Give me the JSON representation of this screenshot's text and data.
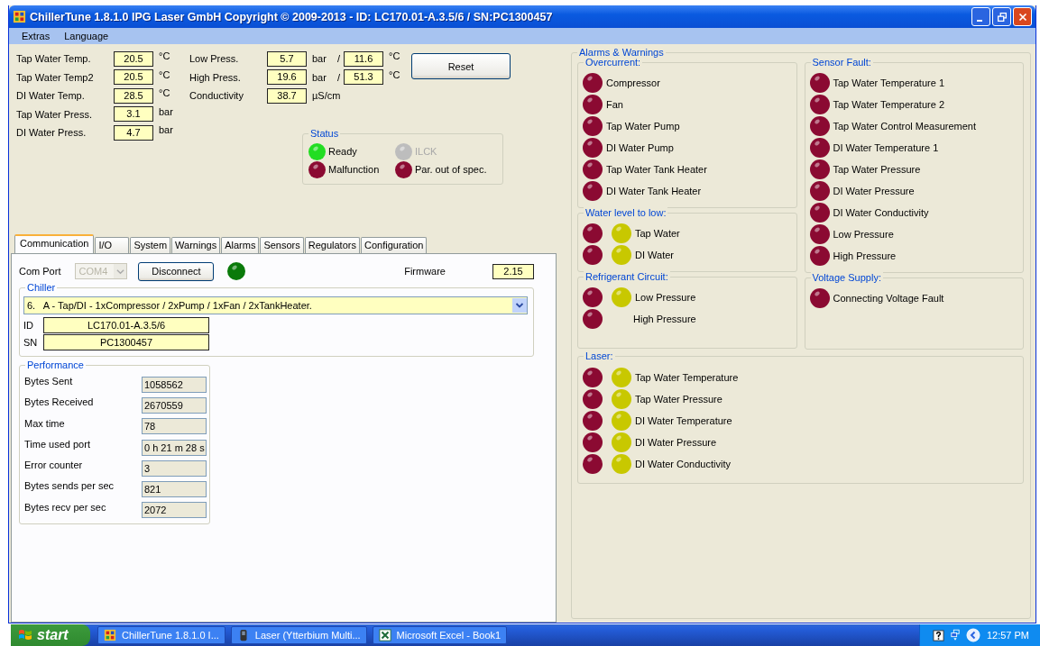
{
  "window": {
    "title": "ChillerTune 1.8.1.0 IPG Laser GmbH Copyright © 2009-2013 - ID: LC170.01-A.3.5/6 / SN:PC1300457"
  },
  "menu": [
    "Extras",
    "Language"
  ],
  "readings_left": [
    {
      "label": "Tap Water Temp.",
      "value": "20.5",
      "unit": "°C"
    },
    {
      "label": "Tap Water Temp2",
      "value": "20.5",
      "unit": "°C"
    },
    {
      "label": "DI Water Temp.",
      "value": "28.5",
      "unit": "°C"
    },
    {
      "label": "Tap Water Press.",
      "value": "3.1",
      "unit": "bar"
    },
    {
      "label": "DI Water Press.",
      "value": "4.7",
      "unit": "bar"
    }
  ],
  "readings_right": [
    {
      "label": "Low Press.",
      "value": "5.7",
      "unit": "bar",
      "separator": "/",
      "value2": "11.6",
      "unit2": "°C"
    },
    {
      "label": "High Press.",
      "value": "19.6",
      "unit": "bar",
      "separator": "/",
      "value2": "51.3",
      "unit2": "°C"
    },
    {
      "label": "Conductivity",
      "value": "38.7",
      "unit": "µS/cm"
    }
  ],
  "reset_button": "Reset",
  "status": {
    "title": "Status",
    "items": [
      {
        "label": "Ready",
        "color": "#22dd22",
        "disabled": false
      },
      {
        "label": "ILCK",
        "color": "#bdbdbd",
        "disabled": true
      },
      {
        "label": "Malfunction",
        "color": "#8b0a32",
        "disabled": false
      },
      {
        "label": "Par. out of spec.",
        "color": "#8b0a32",
        "disabled": false
      }
    ]
  },
  "tabs": [
    {
      "label": "Communication",
      "selected": true
    },
    {
      "label": "I/O",
      "selected": false
    },
    {
      "label": "System",
      "selected": false
    },
    {
      "label": "Warnings",
      "selected": false
    },
    {
      "label": "Alarms",
      "selected": false
    },
    {
      "label": "Sensors",
      "selected": false
    },
    {
      "label": "Regulators",
      "selected": false
    },
    {
      "label": "Configuration",
      "selected": false
    }
  ],
  "communication": {
    "com_port": {
      "label": "Com Port",
      "value": "COM4",
      "disabled": true
    },
    "disconnect_button": "Disconnect",
    "connection_led": {
      "color": "#0a7a0a"
    },
    "firmware": {
      "label": "Firmware",
      "value": "2.15"
    }
  },
  "chiller": {
    "title": "Chiller",
    "model": "6.   A - Tap/DI - 1xCompressor / 2xPump / 1xFan / 2xTankHeater.",
    "fields": [
      {
        "label": "ID",
        "value": "LC170.01-A.3.5/6"
      },
      {
        "label": "SN",
        "value": "PC1300457"
      }
    ]
  },
  "performance": {
    "title": "Performance",
    "rows": [
      {
        "label": "Bytes Sent",
        "value": "1058562"
      },
      {
        "label": "Bytes Received",
        "value": "2670559"
      },
      {
        "label": "Max time",
        "value": "78"
      },
      {
        "label": "Time used port",
        "value": "0 h 21 m 28 s"
      },
      {
        "label": "Error counter",
        "value": "3"
      },
      {
        "label": "Bytes sends per sec",
        "value": "821"
      },
      {
        "label": "Bytes recv per sec",
        "value": "2072"
      }
    ]
  },
  "alarms": {
    "title": "Alarms & Warnings",
    "columns": [
      {
        "groups": [
          {
            "title": "Overcurrent:",
            "kind": "single",
            "items": [
              {
                "label": "Compressor",
                "leds": [
                  {
                    "color": "#8b0a32"
                  }
                ]
              },
              {
                "label": "Fan",
                "leds": [
                  {
                    "color": "#8b0a32"
                  }
                ]
              },
              {
                "label": "Tap Water Pump",
                "leds": [
                  {
                    "color": "#8b0a32"
                  }
                ]
              },
              {
                "label": "DI Water Pump",
                "leds": [
                  {
                    "color": "#8b0a32"
                  }
                ]
              },
              {
                "label": "Tap Water Tank Heater",
                "leds": [
                  {
                    "color": "#8b0a32"
                  }
                ]
              },
              {
                "label": "DI Water Tank Heater",
                "leds": [
                  {
                    "color": "#8b0a32"
                  }
                ]
              }
            ]
          },
          {
            "title": "Water level to low:",
            "kind": "dual",
            "items": [
              {
                "label": "Tap Water",
                "leds": [
                  {
                    "color": "#8b0a32"
                  },
                  {
                    "color": "#c8c800"
                  }
                ]
              },
              {
                "label": "DI Water",
                "leds": [
                  {
                    "color": "#8b0a32"
                  },
                  {
                    "color": "#c8c800"
                  }
                ]
              }
            ]
          },
          {
            "title": "Refrigerant Circuit:",
            "kind": "dual",
            "items": [
              {
                "label": "Low Pressure",
                "leds": [
                  {
                    "color": "#8b0a32"
                  },
                  {
                    "color": "#c8c800"
                  }
                ]
              },
              {
                "label": "High Pressure",
                "leds": [
                  {
                    "color": "#8b0a32"
                  }
                ]
              }
            ]
          }
        ]
      },
      {
        "groups": [
          {
            "title": "Sensor Fault:",
            "kind": "single",
            "items": [
              {
                "label": "Tap Water Temperature 1",
                "leds": [
                  {
                    "color": "#8b0a32"
                  }
                ]
              },
              {
                "label": "Tap Water Temperature 2",
                "leds": [
                  {
                    "color": "#8b0a32"
                  }
                ]
              },
              {
                "label": "Tap Water Control Measurement",
                "leds": [
                  {
                    "color": "#8b0a32"
                  }
                ]
              },
              {
                "label": "DI Water Temperature 1",
                "leds": [
                  {
                    "color": "#8b0a32"
                  }
                ]
              },
              {
                "label": "Tap Water Pressure",
                "leds": [
                  {
                    "color": "#8b0a32"
                  }
                ]
              },
              {
                "label": "DI Water Pressure",
                "leds": [
                  {
                    "color": "#8b0a32"
                  }
                ]
              },
              {
                "label": "DI Water Conductivity",
                "leds": [
                  {
                    "color": "#8b0a32"
                  }
                ]
              },
              {
                "label": "Low Pressure",
                "leds": [
                  {
                    "color": "#8b0a32"
                  }
                ]
              },
              {
                "label": "High Pressure",
                "leds": [
                  {
                    "color": "#8b0a32"
                  }
                ]
              }
            ]
          },
          {
            "title": "Voltage Supply:",
            "kind": "single",
            "items": [
              {
                "label": "Connecting Voltage Fault",
                "leds": [
                  {
                    "color": "#8b0a32"
                  }
                ]
              }
            ]
          }
        ]
      }
    ],
    "bottom_groups": [
      {
        "title": "Laser:",
        "kind": "dual",
        "items": [
          {
            "label": "Tap Water Temperature",
            "leds": [
              {
                "color": "#8b0a32"
              },
              {
                "color": "#c8c800"
              }
            ]
          },
          {
            "label": "Tap Water Pressure",
            "leds": [
              {
                "color": "#8b0a32"
              },
              {
                "color": "#c8c800"
              }
            ]
          },
          {
            "label": "DI Water Temperature",
            "leds": [
              {
                "color": "#8b0a32"
              },
              {
                "color": "#c8c800"
              }
            ]
          },
          {
            "label": "DI Water Pressure",
            "leds": [
              {
                "color": "#8b0a32"
              },
              {
                "color": "#c8c800"
              }
            ]
          },
          {
            "label": "DI Water Conductivity",
            "leds": [
              {
                "color": "#8b0a32"
              },
              {
                "color": "#c8c800"
              }
            ]
          }
        ]
      }
    ]
  },
  "taskbar": {
    "start": "start",
    "tasks": [
      {
        "label": "ChillerTune 1.8.1.0 I...",
        "kind": "app",
        "selected": false
      },
      {
        "label": "Laser (Ytterbium Multi...",
        "kind": "device",
        "selected": false
      },
      {
        "label": "Microsoft Excel - Book1",
        "kind": "excel",
        "selected": false
      }
    ],
    "clock": "12:57 PM"
  }
}
